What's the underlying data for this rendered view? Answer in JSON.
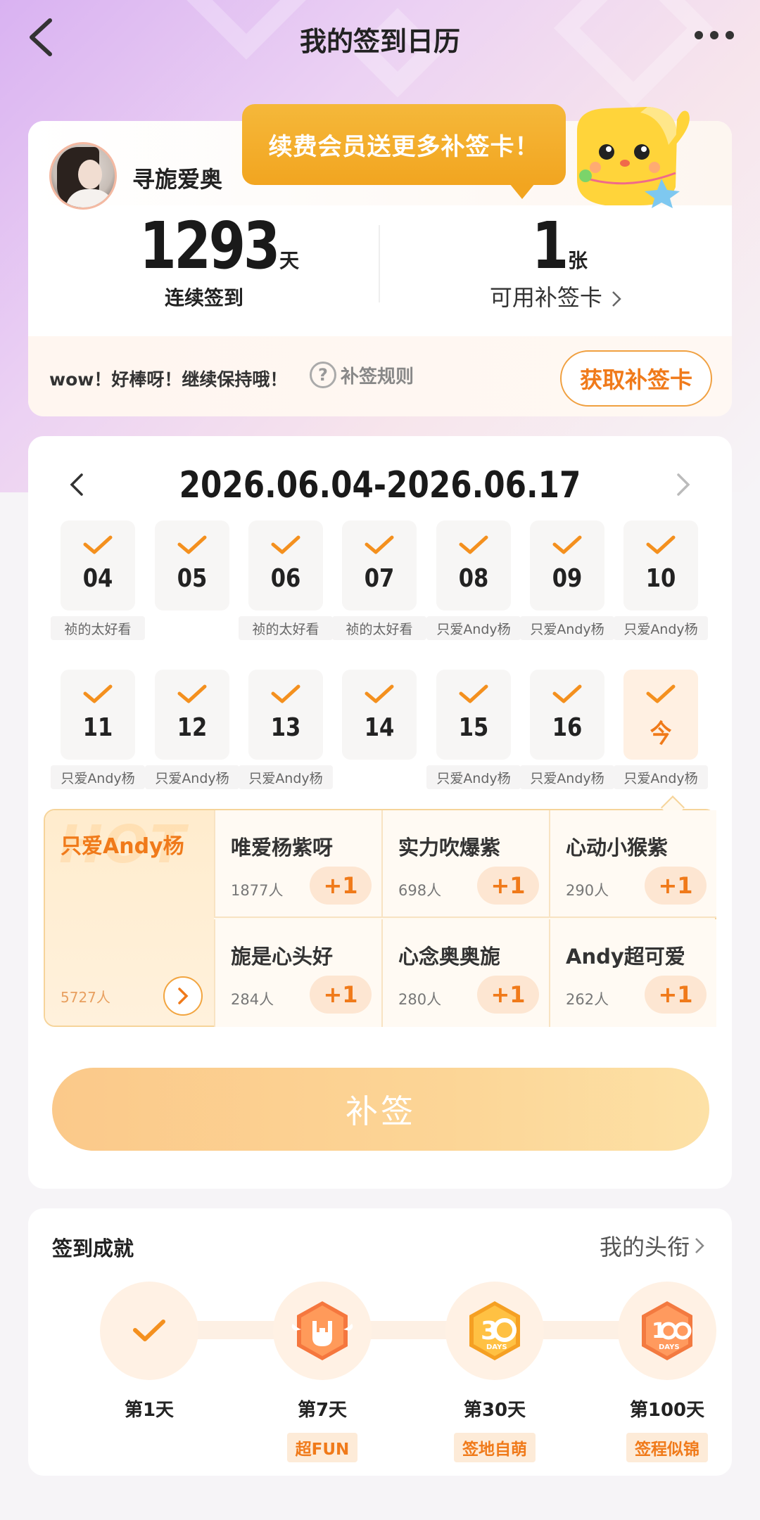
{
  "header": {
    "title": "我的签到日历"
  },
  "user": {
    "name": "寻旎爱奥",
    "promo": "续费会员送更多补签卡！"
  },
  "stats": {
    "streak_value": "1293",
    "streak_unit": "天",
    "streak_label": "连续签到",
    "cards_value": "1",
    "cards_unit": "张",
    "cards_label": "可用补签卡"
  },
  "cheer": {
    "text": "wow！好棒呀！继续保持哦！",
    "rule_label": "补签规则",
    "get_card_label": "获取补签卡"
  },
  "calendar": {
    "range": "2026.06.04-2026.06.17",
    "rows": [
      [
        {
          "num": "04",
          "tag": "祯的太好看"
        },
        {
          "num": "05",
          "tag": ""
        },
        {
          "num": "06",
          "tag": "祯的太好看"
        },
        {
          "num": "07",
          "tag": "祯的太好看"
        },
        {
          "num": "08",
          "tag": "只爱Andy杨"
        },
        {
          "num": "09",
          "tag": "只爱Andy杨"
        },
        {
          "num": "10",
          "tag": "只爱Andy杨"
        }
      ],
      [
        {
          "num": "11",
          "tag": "只爱Andy杨"
        },
        {
          "num": "12",
          "tag": "只爱Andy杨"
        },
        {
          "num": "13",
          "tag": "只爱Andy杨"
        },
        {
          "num": "14",
          "tag": ""
        },
        {
          "num": "15",
          "tag": "只爱Andy杨"
        },
        {
          "num": "16",
          "tag": "只爱Andy杨"
        },
        {
          "num": "今",
          "tag": "只爱Andy杨"
        }
      ]
    ]
  },
  "hot": {
    "watermark": "HOT",
    "main_name": "只爱Andy杨",
    "main_count": "5727人",
    "plus_label": "+1",
    "items": [
      {
        "name": "唯爱杨紫呀",
        "count": "1877人"
      },
      {
        "name": "实力吹爆紫",
        "count": "698人"
      },
      {
        "name": "心动小猴紫",
        "count": "290人"
      },
      {
        "name": "旎是心头好",
        "count": "284人"
      },
      {
        "name": "心念奥奥旎",
        "count": "280人"
      },
      {
        "name": "Andy超可爱",
        "count": "262人"
      }
    ]
  },
  "resign_button": "补签",
  "achievements": {
    "title": "签到成就",
    "link": "我的头衔",
    "items": [
      {
        "day": "第1天",
        "tag": "",
        "icon": "check-badge-icon"
      },
      {
        "day": "第7天",
        "tag": "超FUN",
        "icon": "rock-hand-badge-icon"
      },
      {
        "day": "第30天",
        "tag": "签地自萌",
        "icon": "30-days-badge-icon"
      },
      {
        "day": "第100天",
        "tag": "签程似锦",
        "icon": "100-days-badge-icon"
      }
    ]
  },
  "colors": {
    "accent": "#f07a1a",
    "promo_bg": "#f2a520",
    "resign_btn": "#fbc98a"
  }
}
